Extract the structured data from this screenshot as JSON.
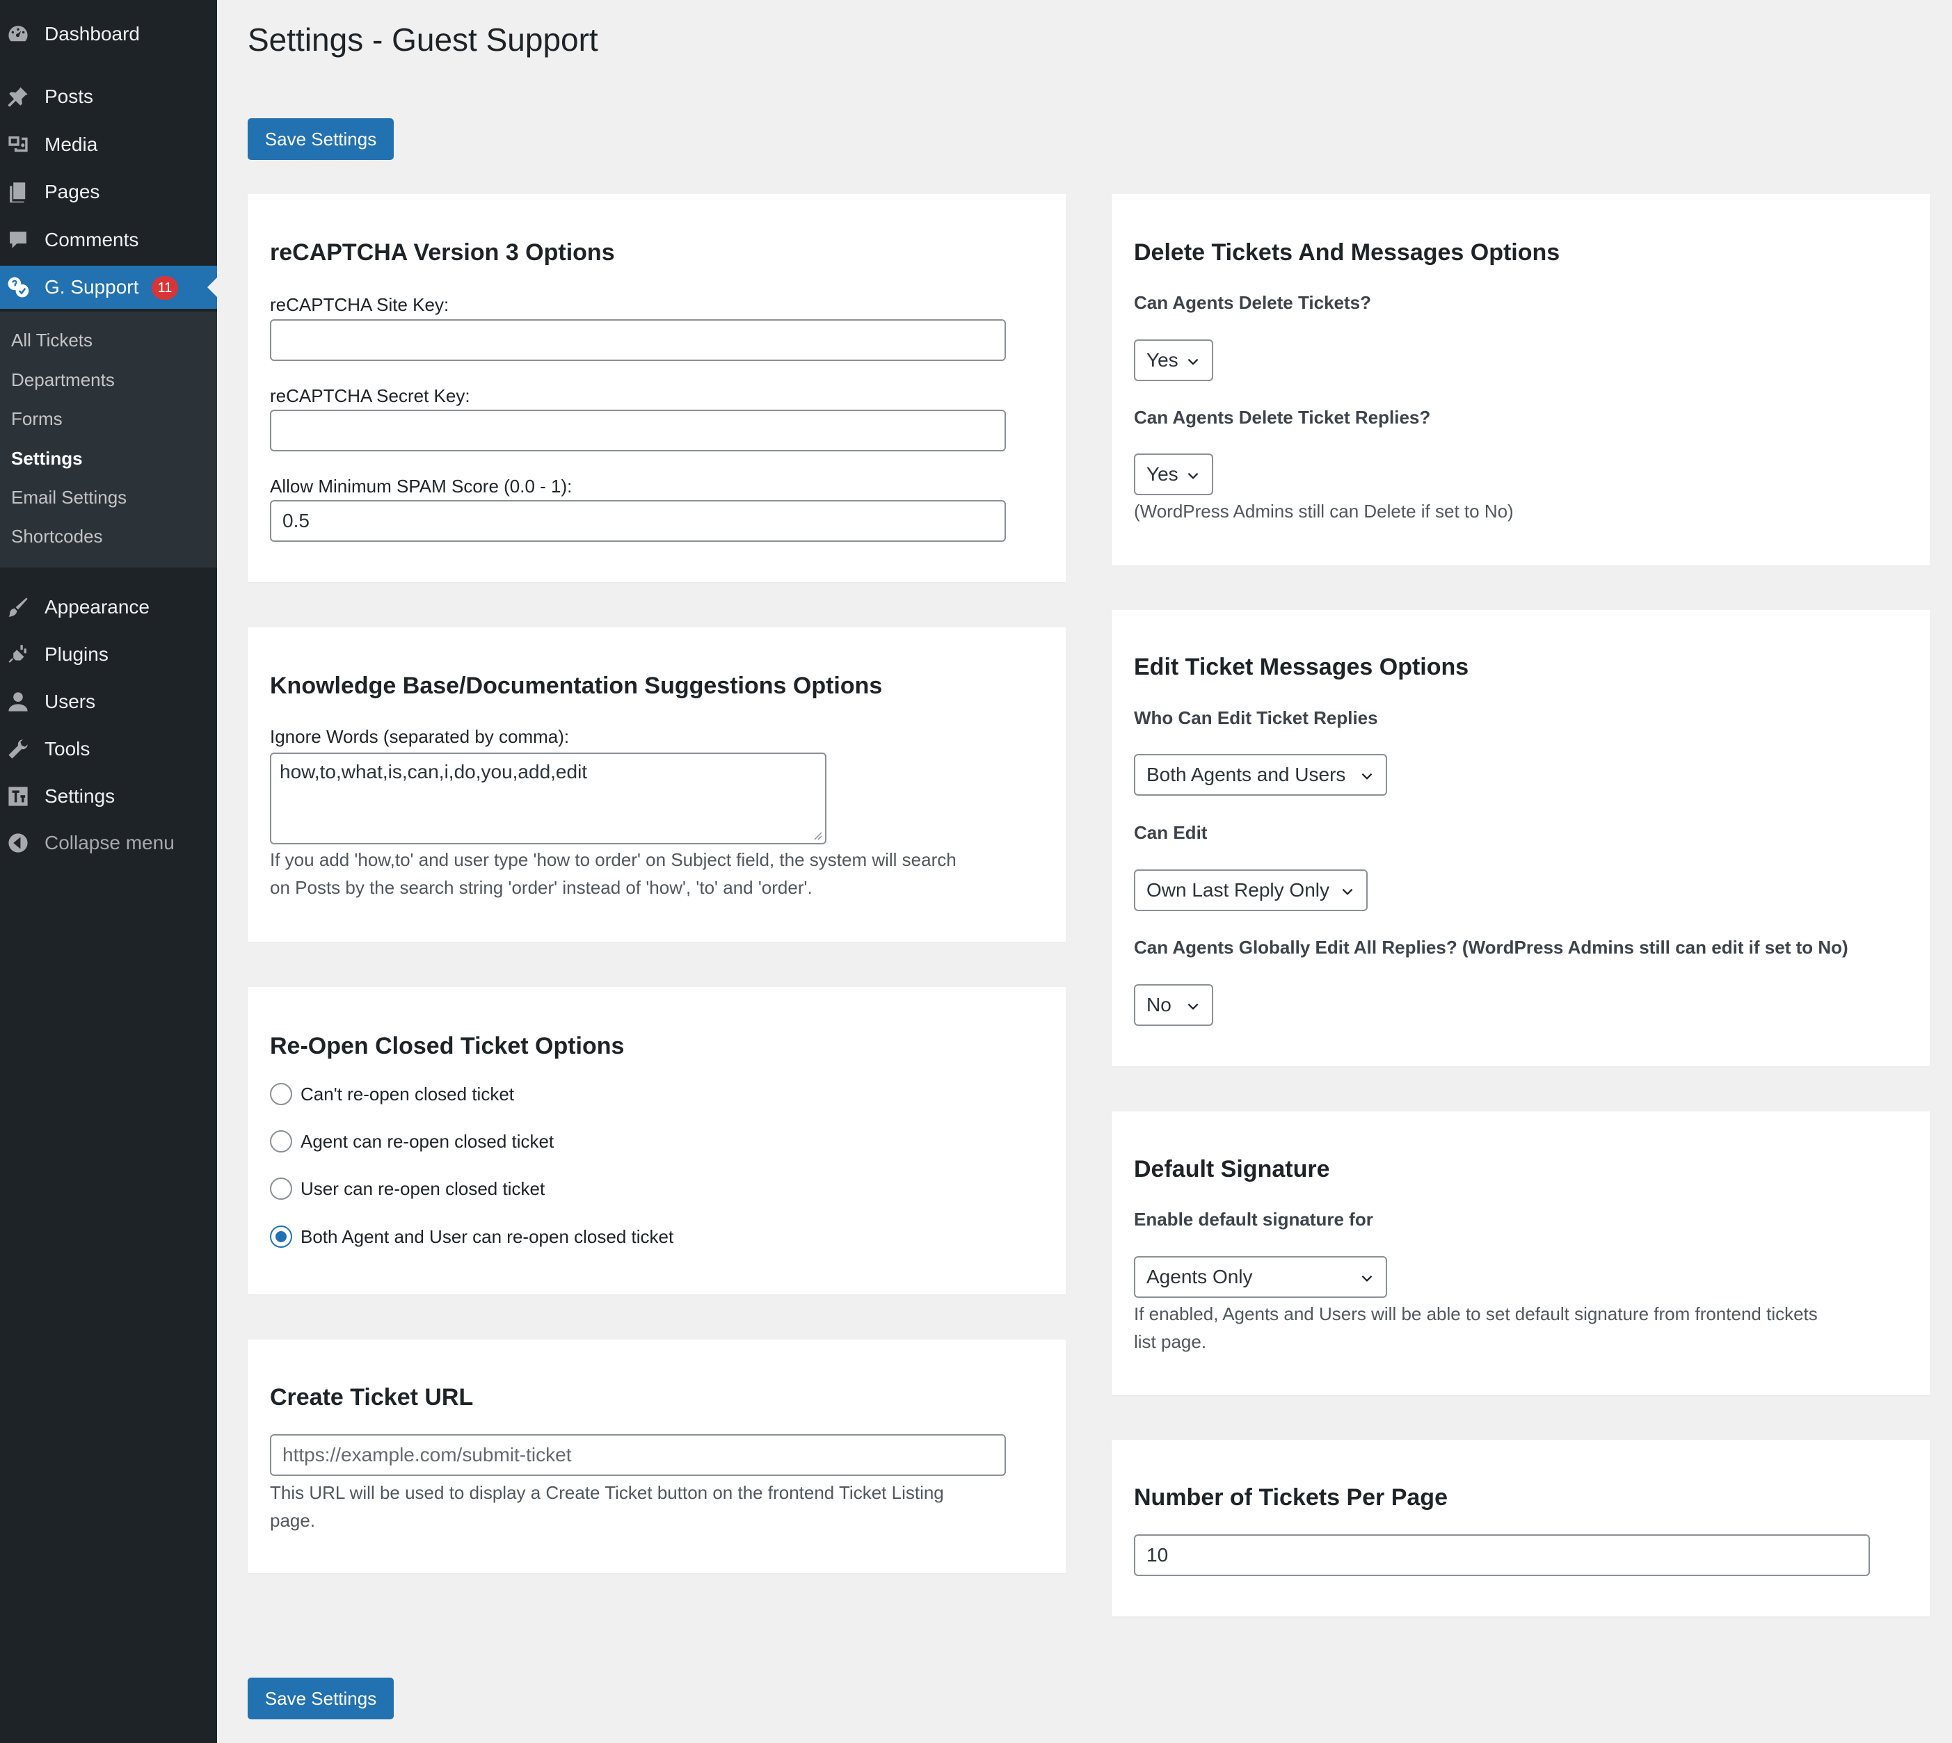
{
  "sidebar": {
    "menu": [
      {
        "label": "Dashboard",
        "icon": "dashboard-icon"
      },
      {
        "label": "Posts",
        "icon": "pin-icon"
      },
      {
        "label": "Media",
        "icon": "media-icon"
      },
      {
        "label": "Pages",
        "icon": "pages-icon"
      },
      {
        "label": "Comments",
        "icon": "comment-icon"
      },
      {
        "label": "G. Support",
        "icon": "support-icon",
        "badge": "11",
        "current": true
      },
      {
        "label": "Appearance",
        "icon": "brush-icon"
      },
      {
        "label": "Plugins",
        "icon": "plugin-icon"
      },
      {
        "label": "Users",
        "icon": "user-icon"
      },
      {
        "label": "Tools",
        "icon": "wrench-icon"
      },
      {
        "label": "Settings",
        "icon": "settings-icon"
      },
      {
        "label": "Collapse menu",
        "icon": "collapse-icon"
      }
    ],
    "submenu": [
      "All Tickets",
      "Departments",
      "Forms",
      "Settings",
      "Email Settings",
      "Shortcodes"
    ],
    "active_submenu": "Settings"
  },
  "page": {
    "title": "Settings - Guest Support",
    "save_label": "Save Settings"
  },
  "recaptcha": {
    "title": "reCAPTCHA Version 3 Options",
    "site_key_label": "reCAPTCHA Site Key:",
    "site_key_value": "",
    "secret_key_label": "reCAPTCHA Secret Key:",
    "secret_key_value": "",
    "min_score_label": "Allow Minimum SPAM Score (0.0 - 1):",
    "min_score_value": "0.5"
  },
  "knowledge_base": {
    "title": "Knowledge Base/Documentation Suggestions Options",
    "ignore_label": "Ignore Words (separated by comma):",
    "ignore_value": "how,to,what,is,can,i,do,you,add,edit",
    "hint_line1": "If you add 'how,to' and user type 'how to order' on Subject field, the system will search",
    "hint_line2": "on Posts by the search string 'order' instead of 'how', 'to' and 'order'."
  },
  "reopen": {
    "title": "Re-Open Closed Ticket Options",
    "options": [
      "Can't re-open closed ticket",
      "Agent can re-open closed ticket",
      "User can re-open closed ticket",
      "Both Agent and User can re-open closed ticket"
    ],
    "selected": 3
  },
  "create_url": {
    "title": "Create Ticket URL",
    "placeholder": "https://example.com/submit-ticket",
    "hint_line1": "This URL will be used to display a Create Ticket button on the frontend Ticket Listing",
    "hint_line2": "page."
  },
  "delete_options": {
    "title": "Delete Tickets And Messages Options",
    "q1": "Can Agents Delete Tickets?",
    "q1_value": "Yes",
    "q2": "Can Agents Delete Ticket Replies?",
    "q2_value": "Yes",
    "note": "(WordPress Admins still can Delete if set to No)"
  },
  "edit_options": {
    "title": "Edit Ticket Messages Options",
    "q1": "Who Can Edit Ticket Replies",
    "q1_value": "Both Agents and Users",
    "q2": "Can Edit",
    "q2_value": "Own Last Reply Only",
    "q3": "Can Agents Globally Edit All Replies? (WordPress Admins still can edit if set to No)",
    "q3_value": "No"
  },
  "signature": {
    "title": "Default Signature",
    "label": "Enable default signature for",
    "value": "Agents Only",
    "hint_line1": "If enabled, Agents and Users will be able to set default signature from frontend tickets",
    "hint_line2": "list page."
  },
  "per_page": {
    "title": "Number of Tickets Per Page",
    "value": "10"
  },
  "colors": {
    "sidebar_bg": "#1d2327",
    "submenu_bg": "#2c3338",
    "accent": "#2271b1",
    "badge": "#d63638",
    "page_bg": "#f0f0f1"
  }
}
